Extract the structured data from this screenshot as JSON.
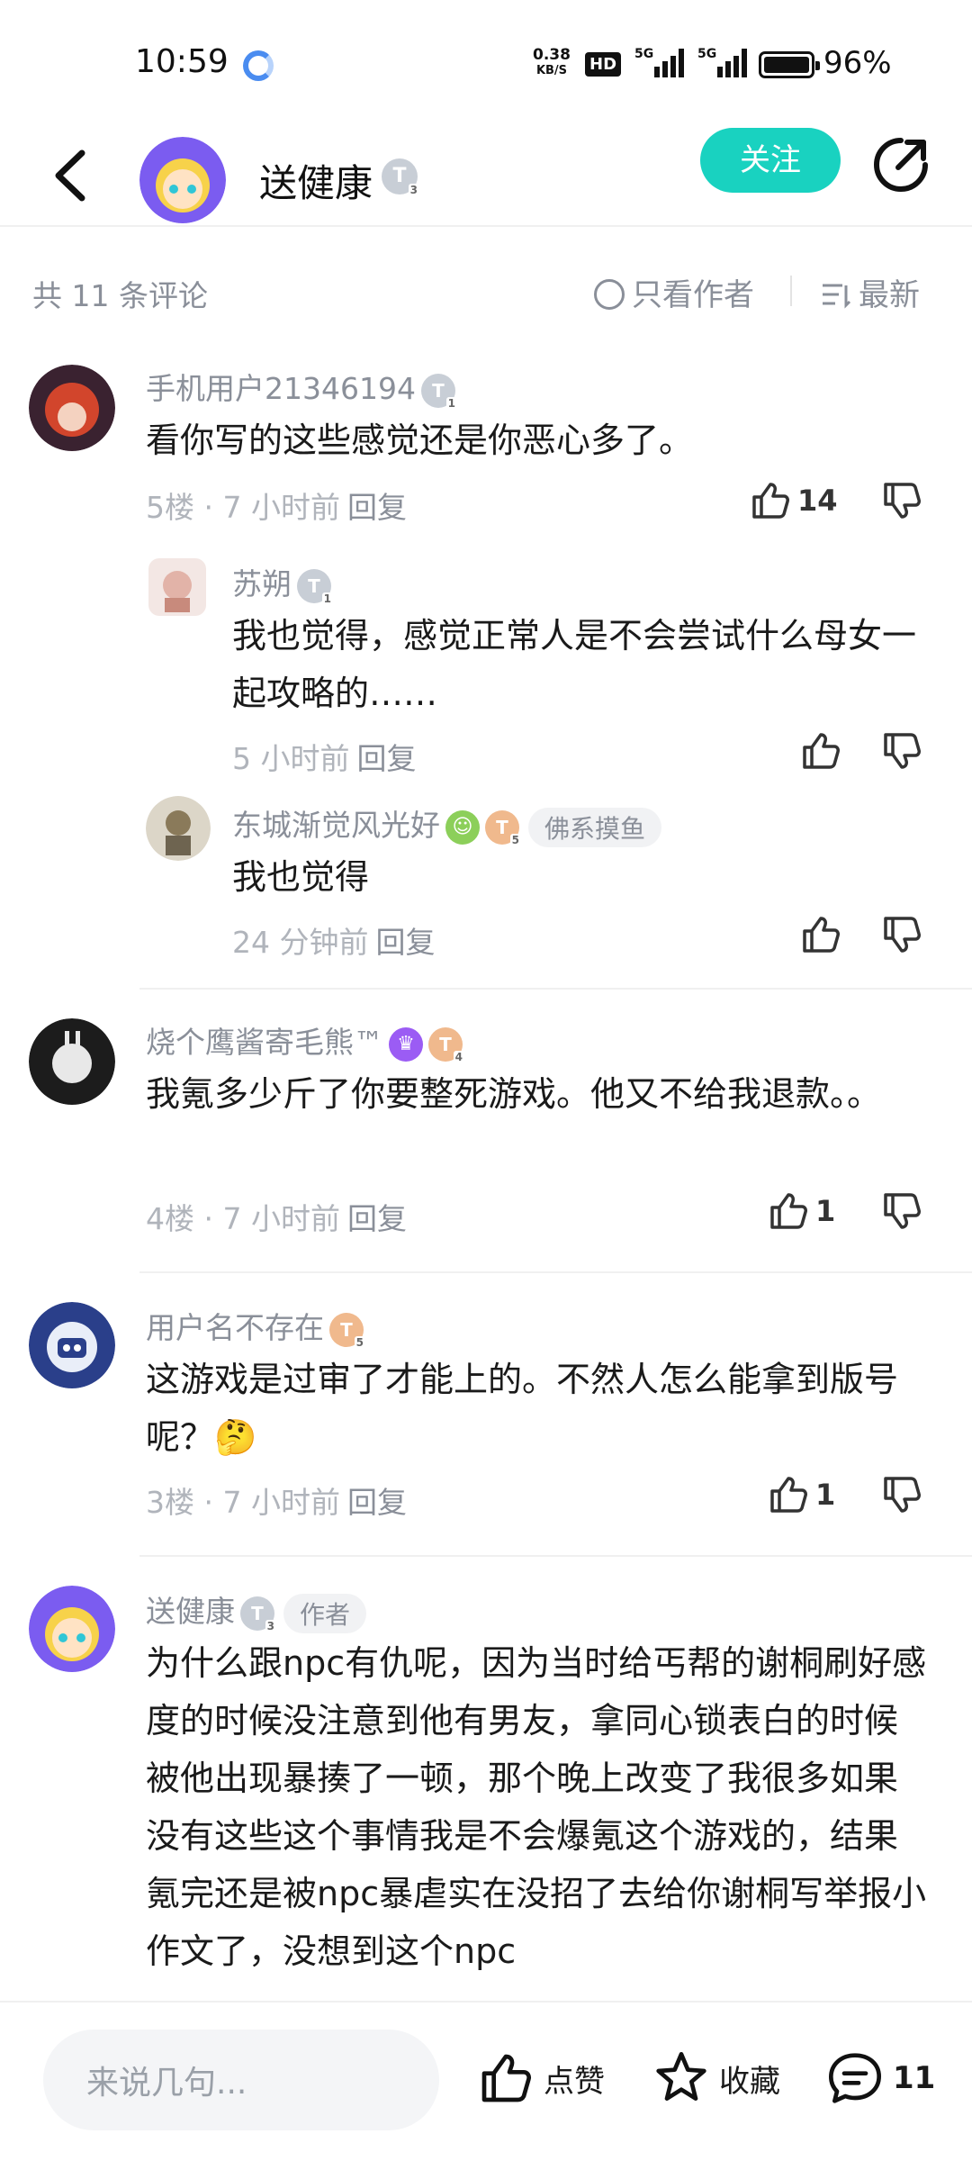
{
  "status_bar": {
    "time": "10:59",
    "net_speed_value": "0.38",
    "net_speed_unit": "KB/S",
    "hd_label": "HD",
    "signal_1": "5G",
    "signal_2": "5G",
    "battery_pct": "96%",
    "battery_level": 0.96
  },
  "header": {
    "back_icon": "chevron-left-icon",
    "user_name": "送健康",
    "level": "T",
    "level_num": "3",
    "follow_label": "关注",
    "share_icon": "share-icon"
  },
  "filter": {
    "count_text": "共 11 条评论",
    "author_only_label": "只看作者",
    "sort_label": "最新"
  },
  "comments": [
    {
      "user": "手机用户21346194",
      "level": "T",
      "level_num": "1",
      "text": "看你写的这些感觉还是你恶心多了。",
      "meta": "5楼 · 7 小时前",
      "reply": "回复",
      "likes": "14",
      "replies": [
        {
          "user": "苏朔",
          "level": "T",
          "level_num": "1",
          "text": "我也觉得，感觉正常人是不会尝试什么母女一起攻略的……",
          "meta": "5 小时前",
          "reply": "回复"
        },
        {
          "user": "东城渐觉风光好",
          "level": "T",
          "level_num": "5",
          "tag": "佛系摸鱼",
          "text": "我也觉得",
          "meta": "24 分钟前",
          "reply": "回复"
        }
      ]
    },
    {
      "user": "烧个鹰酱寄毛熊™",
      "level": "T",
      "level_num": "4",
      "trophy": "♛",
      "text": "我氪多少斤了你要整死游戏。他又不给我退款。。",
      "meta": "4楼 · 7 小时前",
      "reply": "回复",
      "likes": "1"
    },
    {
      "user": "用户名不存在",
      "level": "T",
      "level_num": "5",
      "text": "这游戏是过审了才能上的。不然人怎么能拿到版号呢？",
      "emoji": "🤔",
      "meta": "3楼 · 7 小时前",
      "reply": "回复",
      "likes": "1"
    },
    {
      "user": "送健康",
      "level": "T",
      "level_num": "3",
      "tag": "作者",
      "text": "为什么跟npc有仇呢，因为当时给丐帮的谢桐刷好感度的时候没注意到他有男友，拿同心锁表白的时候被他出现暴揍了一顿，那个晚上改变了我很多如果没有这些这个事情我是不会爆氪这个游戏的，结果氪完还是被npc暴虐实在没招了去给你谢桐写举报小作文了，没想到这个npc"
    }
  ],
  "bottom_bar": {
    "input_placeholder": "来说几句...",
    "like_label": "点赞",
    "fav_label": "收藏",
    "comment_count": "11"
  },
  "colors": {
    "accent": "#19d2c0",
    "secondary_text": "#8a8f99",
    "muted_text": "#b0b4bb"
  }
}
